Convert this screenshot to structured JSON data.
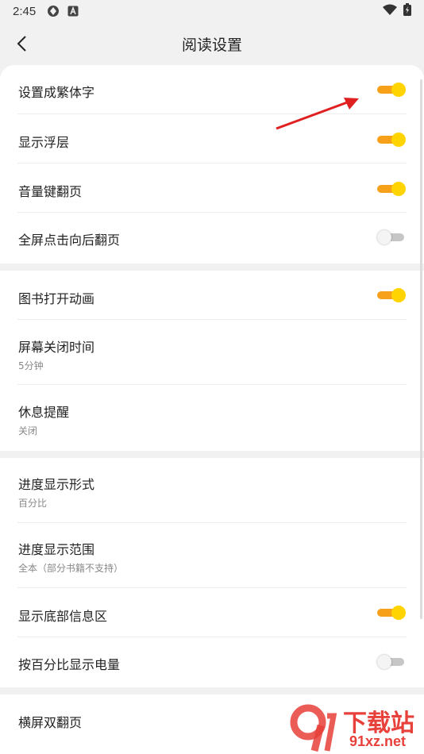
{
  "status_bar": {
    "time": "2:45",
    "icons": [
      "shield-icon",
      "a-badge-icon",
      "wifi-icon",
      "battery-charging-icon"
    ]
  },
  "app_bar": {
    "title": "阅读设置",
    "back_icon": "back-arrow-icon"
  },
  "colors": {
    "toggle_on_track": "#f7a01a",
    "toggle_on_thumb": "#ffd400",
    "toggle_off_track": "#c6c6c6",
    "annotation_arrow": "#e02020",
    "watermark_red": "#e8403a"
  },
  "sections": [
    {
      "items": [
        {
          "label": "设置成繁体字",
          "toggle": "on"
        },
        {
          "label": "显示浮层",
          "toggle": "on"
        },
        {
          "label": "音量键翻页",
          "toggle": "on"
        },
        {
          "label": "全屏点击向后翻页",
          "toggle": "off"
        }
      ]
    },
    {
      "items": [
        {
          "label": "图书打开动画",
          "toggle": "on"
        },
        {
          "label": "屏幕关闭时间",
          "value": "5分钟"
        },
        {
          "label": "休息提醒",
          "value": "关闭"
        }
      ]
    },
    {
      "items": [
        {
          "label": "进度显示形式",
          "value": "百分比"
        },
        {
          "label": "进度显示范围",
          "value": "全本（部分书籍不支持）"
        },
        {
          "label": "显示底部信息区",
          "toggle": "on"
        },
        {
          "label": "按百分比显示电量",
          "toggle": "off"
        }
      ]
    },
    {
      "items": [
        {
          "label": "横屏双翻页"
        }
      ]
    }
  ],
  "watermark": {
    "logo_text": "9",
    "title": "下载站",
    "domain": "91xz.net"
  }
}
